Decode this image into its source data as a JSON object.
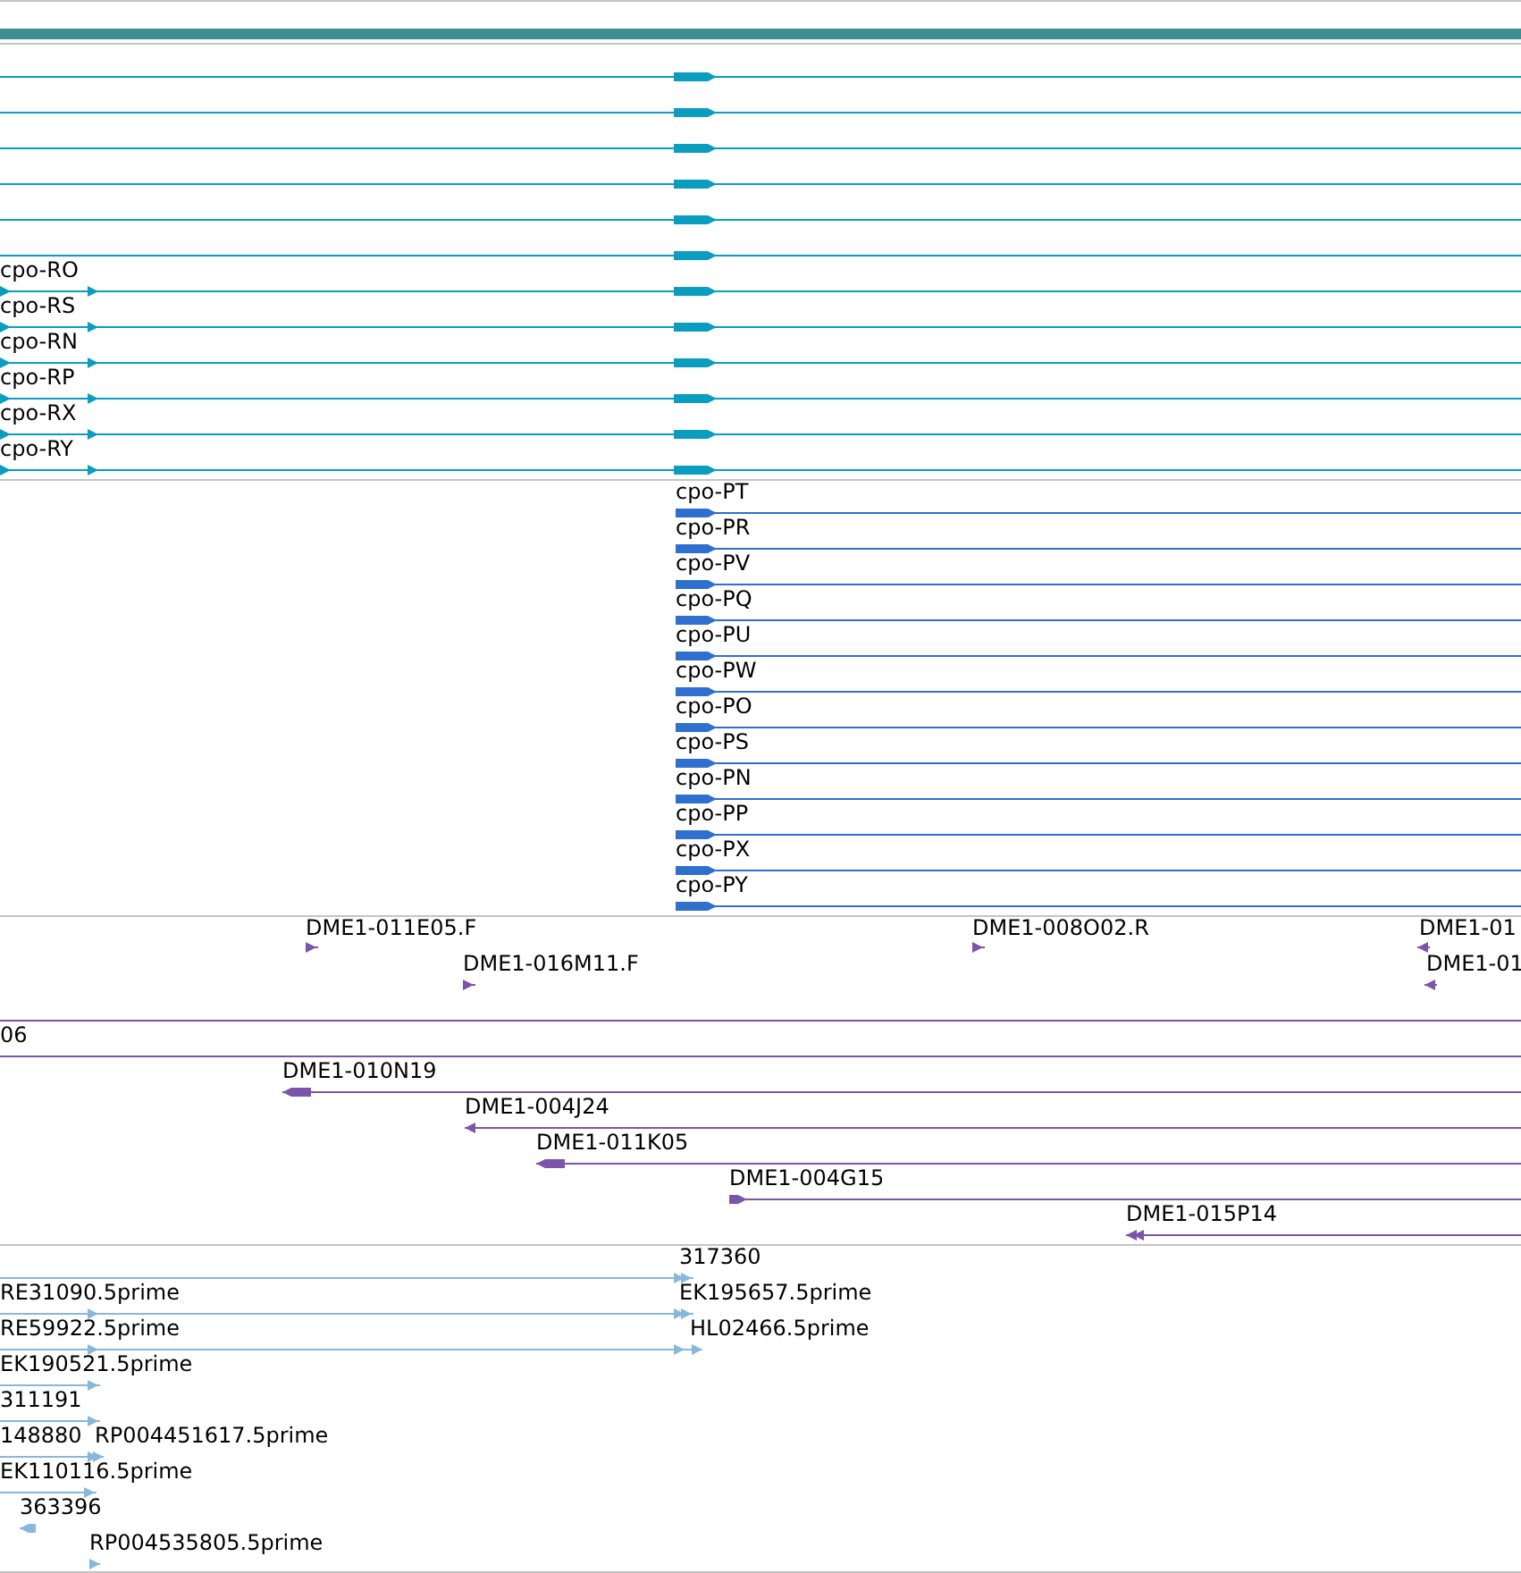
{
  "tracks": [
    {
      "kind": "upper",
      "color": "#0b9dbf",
      "features": [
        {
          "label": "cpo-RO"
        },
        {
          "label": "cpo-RS"
        },
        {
          "label": "cpo-RN"
        },
        {
          "label": "cpo-RP"
        },
        {
          "label": "cpo-RX"
        },
        {
          "label": "cpo-RY"
        }
      ]
    },
    {
      "kind": "lower",
      "color": "#2f6fce",
      "features": [
        {
          "label": "cpo-PT"
        },
        {
          "label": "cpo-PR"
        },
        {
          "label": "cpo-PV"
        },
        {
          "label": "cpo-PQ"
        },
        {
          "label": "cpo-PU"
        },
        {
          "label": "cpo-PW"
        },
        {
          "label": "cpo-PO"
        },
        {
          "label": "cpo-PS"
        },
        {
          "label": "cpo-PN"
        },
        {
          "label": "cpo-PP"
        },
        {
          "label": "cpo-PX"
        },
        {
          "label": "cpo-PY"
        }
      ]
    },
    {
      "kind": "clones",
      "color": "#7a55ab",
      "features": [
        {
          "label": "DME1-011E05.F"
        },
        {
          "label": "DME1-016M11.F"
        },
        {
          "label": "DME1-008O02.R"
        },
        {
          "label": "DME1-01"
        },
        {
          "label": "DME1-01"
        },
        {
          "label": "06"
        },
        {
          "label": "DME1-010N19"
        },
        {
          "label": "DME1-004J24"
        },
        {
          "label": "DME1-011K05"
        },
        {
          "label": "DME1-004G15"
        },
        {
          "label": "DME1-015P14"
        }
      ]
    },
    {
      "kind": "ests",
      "color": "#86b8dc",
      "features": [
        {
          "label": "317360"
        },
        {
          "label": "RE31090.5prime"
        },
        {
          "label": "EK195657.5prime"
        },
        {
          "label": "RE59922.5prime"
        },
        {
          "label": "HL02466.5prime"
        },
        {
          "label": "EK190521.5prime"
        },
        {
          "label": "311191"
        },
        {
          "label": "148880"
        },
        {
          "label": "RP004451617.5prime"
        },
        {
          "label": "EK110116.5prime"
        },
        {
          "label": "363396"
        },
        {
          "label": "RP004535805.5prime"
        }
      ]
    }
  ]
}
